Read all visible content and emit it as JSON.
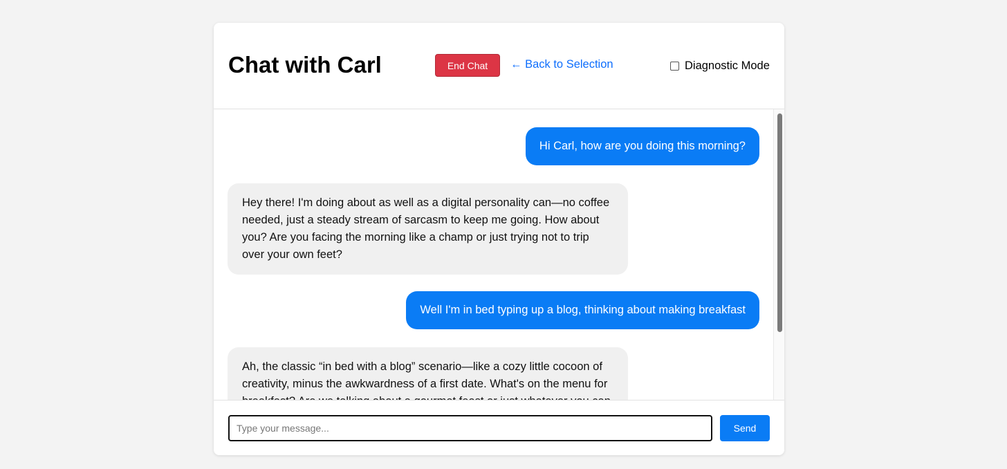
{
  "header": {
    "title": "Chat with Carl",
    "end_chat_label": "End Chat",
    "back_link_label": "← Back to Selection",
    "diagnostic_mode_label": "Diagnostic Mode",
    "diagnostic_mode_checked": false
  },
  "messages": [
    {
      "role": "user",
      "text": "Hi Carl, how are you doing this morning?"
    },
    {
      "role": "bot",
      "text": "Hey there! I'm doing about as well as a digital personality can—no coffee needed, just a steady stream of sarcasm to keep me going. How about you? Are you facing the morning like a champ or just trying not to trip over your own feet?"
    },
    {
      "role": "user",
      "text": "Well I'm in bed typing up a blog, thinking about making breakfast"
    },
    {
      "role": "bot",
      "text": "Ah, the classic “in bed with a blog” scenario—like a cozy little cocoon of creativity, minus the awkwardness of a first date. What's on the menu for breakfast? Are we talking about a gourmet feast or just whatever you can"
    }
  ],
  "composer": {
    "placeholder": "Type your message...",
    "value": "",
    "send_label": "Send"
  },
  "colors": {
    "page_background": "#f3f3f3",
    "user_bubble": "#0a7cf5",
    "bot_bubble": "#f0f0f0",
    "end_chat": "#dc3545",
    "link": "#0d6efd"
  }
}
